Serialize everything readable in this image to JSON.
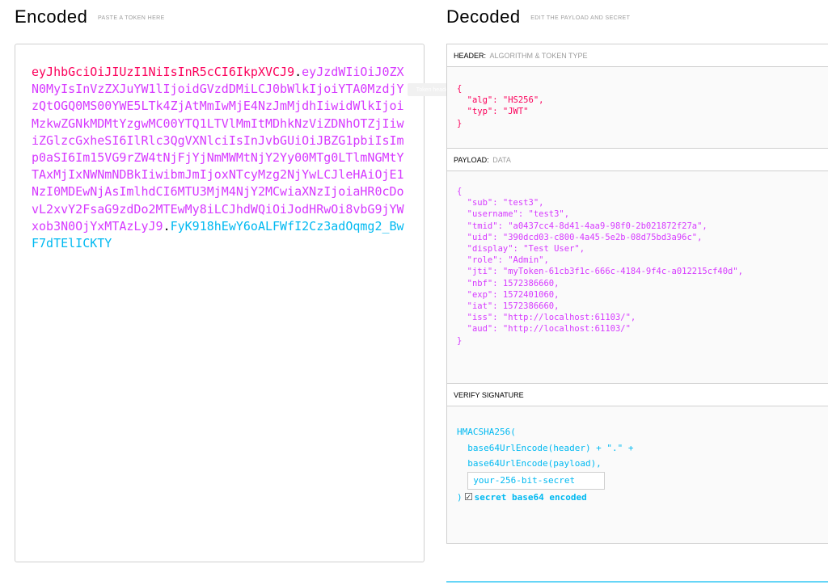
{
  "encoded": {
    "title": "Encoded",
    "subtitle": "PASTE A TOKEN HERE",
    "header_part": "eyJhbGciOiJIUzI1NiIsInR5cCI6IkpXVCJ9",
    "payload_part": "eyJzdWIiOiJ0ZXN0MyIsInVzZXJuYW1lIjoidGVzdDMiLCJ0bWlkIjoiYTA0MzdjYzQtOGQ0MS00YWE5LTk4ZjAtMmIwMjE4NzJmMjdhIiwidWlkIjoiMzkwZGNkMDMtYzgwMC00YTQ1LTVlMmItMDhkNzViZDNhOTZjIiwiZGlzcGxheSI6IlRlc3QgVXNlciIsInJvbGUiOiJBZG1pbiIsImp0aSI6Im15VG9rZW4tNjFjYjNmMWMtNjY2Yy00MTg0LTlmNGMtYTAxMjIxNWNmNDBkIiwibmJmIjoxNTcyMzg2NjYwLCJleHAiOjE1NzI0MDEwNjAsImlhdCI6MTU3MjM4NjY2MCwiaXNzIjoiaHR0cDovL2xvY2FsaG9zdDo2MTEwMy8iLCJhdWQiOiJodHRwOi8vbG9jYWxob3N0OjYxMTAzLyJ9",
    "signature_part": "FyK918hEwY6oALFWfI2Cz3adOqmg2_BwF7dTElICKTY",
    "dot": "."
  },
  "tooltip": {
    "text": "Token header"
  },
  "decoded": {
    "title": "Decoded",
    "subtitle": "EDIT THE PAYLOAD AND SECRET",
    "header_panel": {
      "label": "HEADER:",
      "sublabel": "ALGORITHM & TOKEN TYPE",
      "json": "{\n  \"alg\": \"HS256\",\n  \"typ\": \"JWT\"\n}"
    },
    "payload_panel": {
      "label": "PAYLOAD:",
      "sublabel": "DATA",
      "json": "{\n  \"sub\": \"test3\",\n  \"username\": \"test3\",\n  \"tmid\": \"a0437cc4-8d41-4aa9-98f0-2b021872f27a\",\n  \"uid\": \"390dcd03-c800-4a45-5e2b-08d75bd3a96c\",\n  \"display\": \"Test User\",\n  \"role\": \"Admin\",\n  \"jti\": \"myToken-61cb3f1c-666c-4184-9f4c-a012215cf40d\",\n  \"nbf\": 1572386660,\n  \"exp\": 1572401060,\n  \"iat\": 1572386660,\n  \"iss\": \"http://localhost:61103/\",\n  \"aud\": \"http://localhost:61103/\"\n}"
    },
    "verify_panel": {
      "label": "VERIFY SIGNATURE",
      "line1": "HMACSHA256(",
      "line2": "  base64UrlEncode(header) + \".\" +",
      "line3": "  base64UrlEncode(payload),",
      "secret_value": "your-256-bit-secret",
      "close_paren": ")",
      "checkbox_label": "secret base64 encoded",
      "checkbox_checked": true
    }
  }
}
